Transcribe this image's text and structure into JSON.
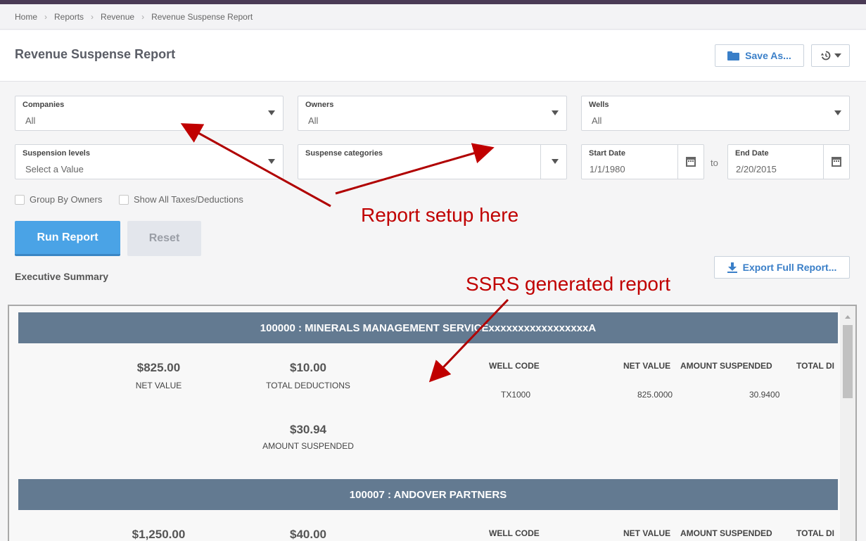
{
  "breadcrumb": [
    "Home",
    "Reports",
    "Revenue",
    "Revenue Suspense Report"
  ],
  "page_title": "Revenue Suspense Report",
  "toolbar": {
    "save_as_label": "Save As...",
    "history_icon": "history-icon"
  },
  "filters": {
    "companies": {
      "label": "Companies",
      "value": "All"
    },
    "owners": {
      "label": "Owners",
      "value": "All"
    },
    "wells": {
      "label": "Wells",
      "value": "All"
    },
    "suspension_levels": {
      "label": "Suspension levels",
      "value": "Select a Value"
    },
    "suspense_categories": {
      "label": "Suspense categories",
      "value": ""
    },
    "start_date": {
      "label": "Start Date",
      "value": "1/1/1980"
    },
    "to_label": "to",
    "end_date": {
      "label": "End Date",
      "value": "2/20/2015"
    }
  },
  "options": {
    "group_by_owners": "Group By Owners",
    "show_all_taxes": "Show All Taxes/Deductions"
  },
  "actions": {
    "run_report": "Run Report",
    "reset": "Reset",
    "export_full_report": "Export Full Report..."
  },
  "executive_summary_label": "Executive Summary",
  "report": {
    "columns": {
      "well_code": "WELL CODE",
      "net_value": "NET VALUE",
      "amount_suspended": "AMOUNT SUSPENDED",
      "total_deductions_cut": "TOTAL DI"
    },
    "groups": [
      {
        "title": "100000 : MINERALS MANAGEMENT SERVICExxxxxxxxxxxxxxxxxA",
        "net_value": "$825.00",
        "net_value_label": "NET VALUE",
        "total_deductions": "$10.00",
        "total_deductions_label": "TOTAL DEDUCTIONS",
        "amount_suspended": "$30.94",
        "amount_suspended_label": "AMOUNT SUSPENDED",
        "rows": [
          {
            "well_code": "TX1000",
            "net_value": "825.0000",
            "amount_suspended": "30.9400"
          }
        ]
      },
      {
        "title": "100007 : ANDOVER PARTNERS",
        "net_value": "$1,250.00",
        "total_deductions": "$40.00"
      }
    ]
  },
  "annotations": {
    "setup": "Report setup here",
    "ssrs": "SSRS generated report"
  },
  "colors": {
    "accent": "#3a7fc8",
    "run_button": "#4aa3e6",
    "group_header": "#637a91",
    "annotation": "#c00000",
    "topbar": "#4a3a55"
  }
}
